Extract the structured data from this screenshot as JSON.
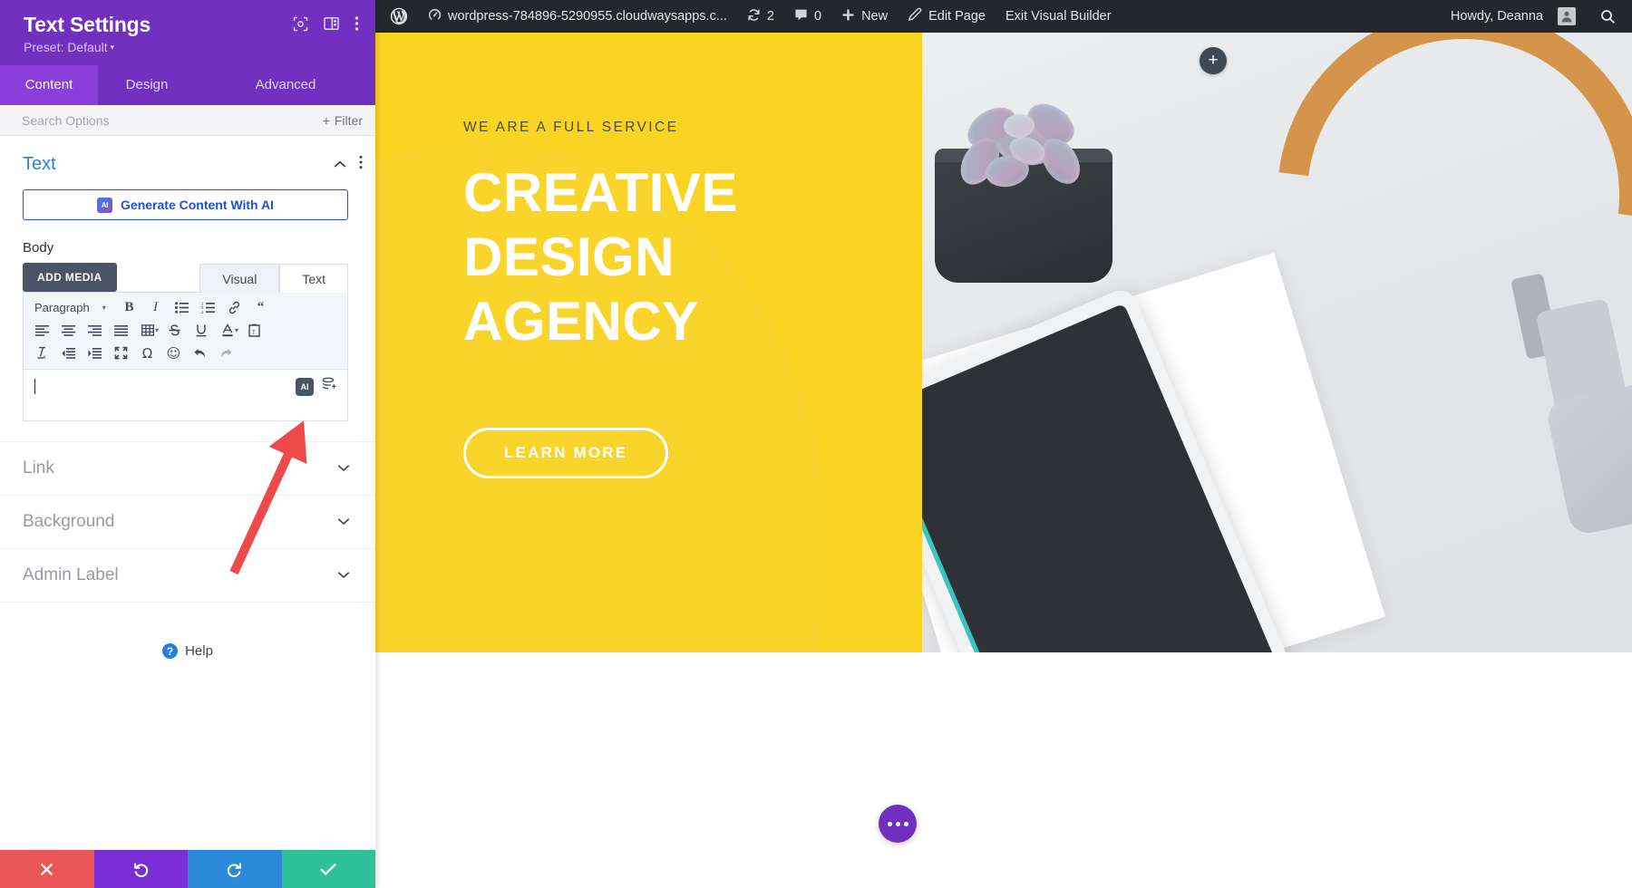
{
  "settings_panel": {
    "title": "Text Settings",
    "preset": "Preset: Default",
    "preset_caret": "▾",
    "header_icons": [
      {
        "name": "focus-target-icon"
      },
      {
        "name": "layout-panel-icon"
      },
      {
        "name": "more-vertical-icon"
      }
    ],
    "tabs": [
      {
        "label": "Content",
        "active": true
      },
      {
        "label": "Design",
        "active": false
      },
      {
        "label": "Advanced",
        "active": false
      }
    ],
    "search": {
      "placeholder": "Search Options"
    },
    "filter_button": {
      "label": "Filter",
      "icon": "plus-icon"
    },
    "text_section": {
      "title": "Text",
      "collapse_icon": "chevron-up-icon",
      "menu_icon": "more-vertical-icon",
      "ai_button": {
        "label": "Generate Content With AI",
        "badge": "AI"
      }
    },
    "body_field": {
      "label": "Body",
      "add_media_label": "ADD MEDIA",
      "editor_tabs": [
        {
          "label": "Visual",
          "active": true
        },
        {
          "label": "Text",
          "active": false
        }
      ],
      "format_select": "Paragraph",
      "toolbar_row1": [
        {
          "name": "bold-icon",
          "glyph": "B"
        },
        {
          "name": "italic-icon",
          "glyph": "I"
        },
        {
          "name": "bulleted-list-icon"
        },
        {
          "name": "numbered-list-icon"
        },
        {
          "name": "link-icon"
        },
        {
          "name": "blockquote-icon",
          "glyph": "“"
        }
      ],
      "toolbar_row2": [
        {
          "name": "align-left-icon"
        },
        {
          "name": "align-center-icon"
        },
        {
          "name": "align-right-icon"
        },
        {
          "name": "align-justify-icon"
        },
        {
          "name": "table-icon"
        },
        {
          "name": "strikethrough-icon",
          "glyph": "S"
        },
        {
          "name": "underline-icon",
          "glyph": "U"
        },
        {
          "name": "text-color-icon",
          "glyph": "A"
        },
        {
          "name": "paste-as-text-icon"
        }
      ],
      "toolbar_row3": [
        {
          "name": "clear-formatting-icon"
        },
        {
          "name": "outdent-icon"
        },
        {
          "name": "indent-icon"
        },
        {
          "name": "fullscreen-icon"
        },
        {
          "name": "special-character-icon",
          "glyph": "Ω"
        },
        {
          "name": "emoji-icon",
          "glyph": "☺"
        },
        {
          "name": "undo-icon"
        },
        {
          "name": "redo-icon"
        }
      ],
      "content_value": "",
      "inline_actions": [
        {
          "name": "ai-assist-button",
          "label": "AI"
        },
        {
          "name": "content-layers-button"
        }
      ]
    },
    "accordion": [
      {
        "label": "Link",
        "icon": "chevron-down-icon"
      },
      {
        "label": "Background",
        "icon": "chevron-down-icon"
      },
      {
        "label": "Admin Label",
        "icon": "chevron-down-icon"
      }
    ],
    "help": {
      "label": "Help",
      "glyph": "?"
    },
    "actions": [
      {
        "name": "discard-changes-button",
        "icon": "close-icon",
        "color": "#e9575a"
      },
      {
        "name": "undo-button",
        "icon": "undo-icon",
        "color": "#7a2fd6"
      },
      {
        "name": "redo-button",
        "icon": "redo-icon",
        "color": "#2b8ad9"
      },
      {
        "name": "save-changes-button",
        "icon": "check-icon",
        "color": "#2ec19b"
      }
    ]
  },
  "admin_bar": {
    "wp_logo": "wordpress-logo-icon",
    "site_name": "wordpress-784896-5290955.cloudwaysapps.c...",
    "site_icon": "dashboard-icon",
    "updates": {
      "icon": "updates-icon",
      "count": "2"
    },
    "comments": {
      "icon": "comment-icon",
      "count": "0"
    },
    "new": {
      "icon": "plus-icon",
      "label": "New"
    },
    "edit_page": {
      "icon": "pencil-icon",
      "label": "Edit Page"
    },
    "exit_builder": {
      "label": "Exit Visual Builder"
    },
    "howdy": "Howdy, Deanna",
    "avatar": "user-avatar",
    "search": "search-icon"
  },
  "preview": {
    "add_section_button": {
      "icon": "plus-icon"
    },
    "hero": {
      "kicker": "WE ARE A FULL SERVICE",
      "heading_lines": [
        "CREATIVE",
        "DESIGN",
        "AGENCY"
      ],
      "cta_label": "LEARN MORE",
      "bg_color": "#f9d423",
      "heading_color": "#ffffff"
    },
    "fab": {
      "name": "page-settings-fab",
      "icon": "ellipsis-icon",
      "color": "#7230c0"
    }
  }
}
